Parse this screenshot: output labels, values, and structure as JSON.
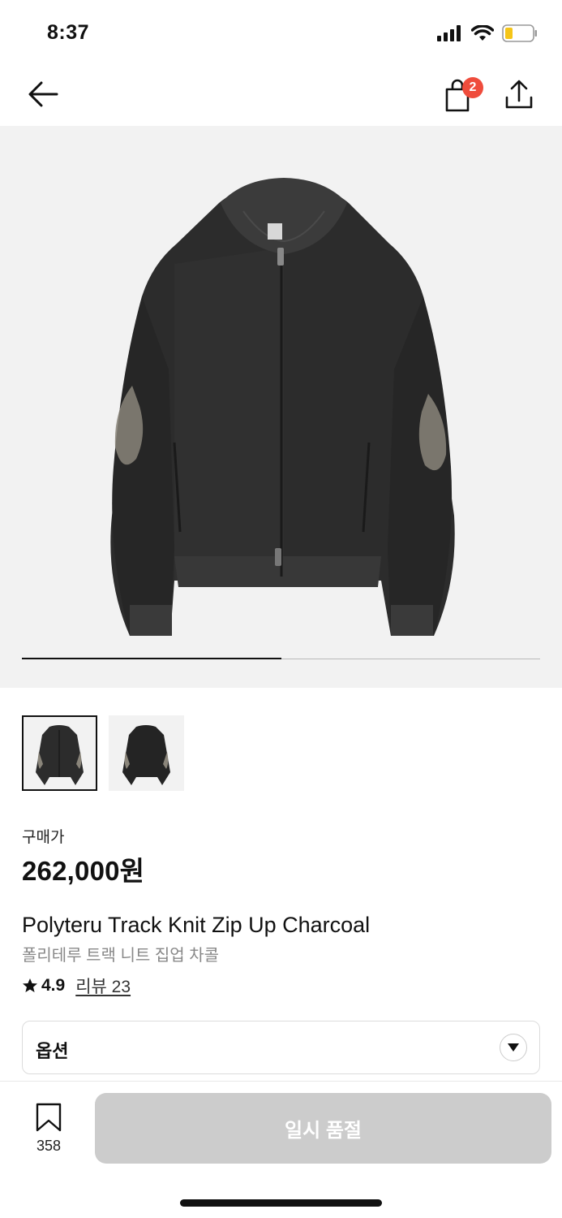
{
  "status_bar": {
    "time": "8:37"
  },
  "nav": {
    "cart_count": "2"
  },
  "gallery": {
    "progress": 0.5,
    "thumbnail_count": 2,
    "selected_index": 0
  },
  "product": {
    "price_label": "구매가",
    "price": "262,000원",
    "name_en": "Polyteru Track Knit Zip Up Charcoal",
    "name_ko": "폴리테루 트랙 니트 집업 차콜",
    "rating": "4.9",
    "review_link": "리뷰 23"
  },
  "option": {
    "label": "옵션"
  },
  "bottom_bar": {
    "bookmark_count": "358",
    "cta_label": "일시 품절"
  },
  "colors": {
    "badge": "#ef4c3c",
    "cta_disabled": "#cccccc",
    "hero_bg": "#f2f2f2"
  },
  "icons": [
    "back-arrow-icon",
    "shopping-bag-icon",
    "share-icon",
    "star-icon",
    "chevron-down-icon",
    "bookmark-icon",
    "signal-icon",
    "wifi-icon",
    "battery-icon"
  ]
}
